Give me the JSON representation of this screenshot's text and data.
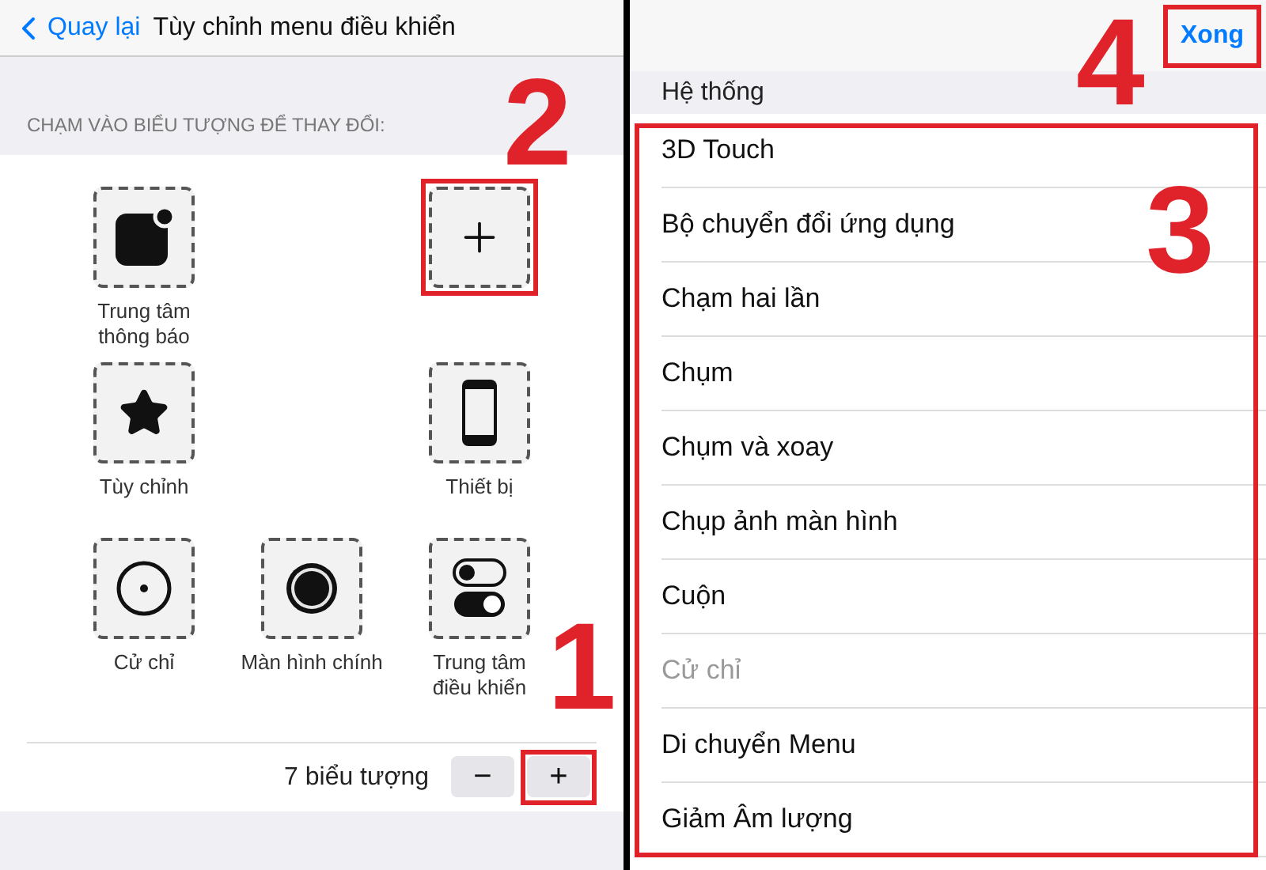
{
  "left_panel": {
    "back_label": "Quay lại",
    "title": "Tùy chỉnh menu điều khiển",
    "section_header": "CHẠM VÀO BIỂU TƯỢNG ĐỂ THAY ĐỔI:",
    "slots": [
      {
        "kind": "notification",
        "label": "Trung tâm\nthông báo",
        "highlighted": false
      },
      {
        "kind": "empty"
      },
      {
        "kind": "add",
        "highlighted": true
      },
      {
        "kind": "star",
        "label": "Tùy chỉnh",
        "highlighted": false
      },
      {
        "kind": "empty"
      },
      {
        "kind": "device",
        "label": "Thiết bị",
        "highlighted": false
      },
      {
        "kind": "gesture",
        "label": "Cử chỉ",
        "highlighted": false
      },
      {
        "kind": "home",
        "label": "Màn hình chính",
        "highlighted": false
      },
      {
        "kind": "control",
        "label": "Trung tâm\nđiều khiển",
        "highlighted": false
      }
    ],
    "count_label": "7 biểu tượng",
    "stepper": [
      {
        "label": "−",
        "highlighted": false
      },
      {
        "label": "+",
        "highlighted": true
      }
    ]
  },
  "right_panel": {
    "done_button": {
      "label": "Xong",
      "highlighted": true
    },
    "section_header": "Hệ thống",
    "list_highlighted": true,
    "items": [
      {
        "label": "3D Touch",
        "disabled": false
      },
      {
        "label": "Bộ chuyển đổi ứng dụng",
        "disabled": false
      },
      {
        "label": "Chạm hai lần",
        "disabled": false
      },
      {
        "label": "Chụm",
        "disabled": false
      },
      {
        "label": "Chụm và xoay",
        "disabled": false
      },
      {
        "label": "Chụp ảnh màn hình",
        "disabled": false
      },
      {
        "label": "Cuộn",
        "disabled": false
      },
      {
        "label": "Cử chỉ",
        "disabled": true
      },
      {
        "label": "Di chuyển Menu",
        "disabled": false
      },
      {
        "label": "Giảm Âm lượng",
        "disabled": false
      }
    ]
  },
  "annotations": [
    {
      "number": "2"
    },
    {
      "number": "1"
    },
    {
      "number": "4"
    },
    {
      "number": "3"
    }
  ]
}
